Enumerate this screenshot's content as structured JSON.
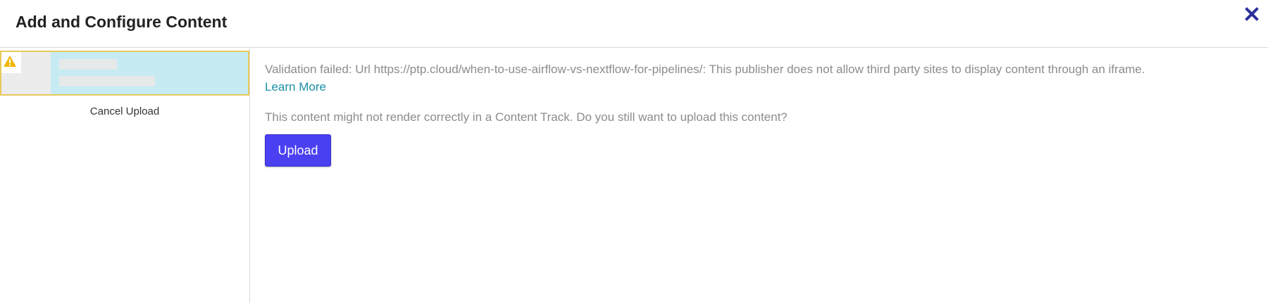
{
  "header": {
    "title": "Add and Configure Content",
    "close_icon": "close-icon",
    "close_color": "#2c2f9a"
  },
  "sidebar": {
    "item": {
      "status_icon": "warning-icon",
      "status_color": "#f2b705",
      "highlight_color": "#c6ebf2"
    },
    "cancel_label": "Cancel Upload"
  },
  "content": {
    "validation_message": "Validation failed: Url https://ptp.cloud/when-to-use-airflow-vs-nextflow-for-pipelines/: This publisher does not allow third party sites to display content through an iframe.",
    "learn_more_label": "Learn More",
    "question": "This content might not render correctly in a Content Track. Do you still want to upload this content?",
    "upload_label": "Upload",
    "accent_color": "#4a40f2"
  }
}
